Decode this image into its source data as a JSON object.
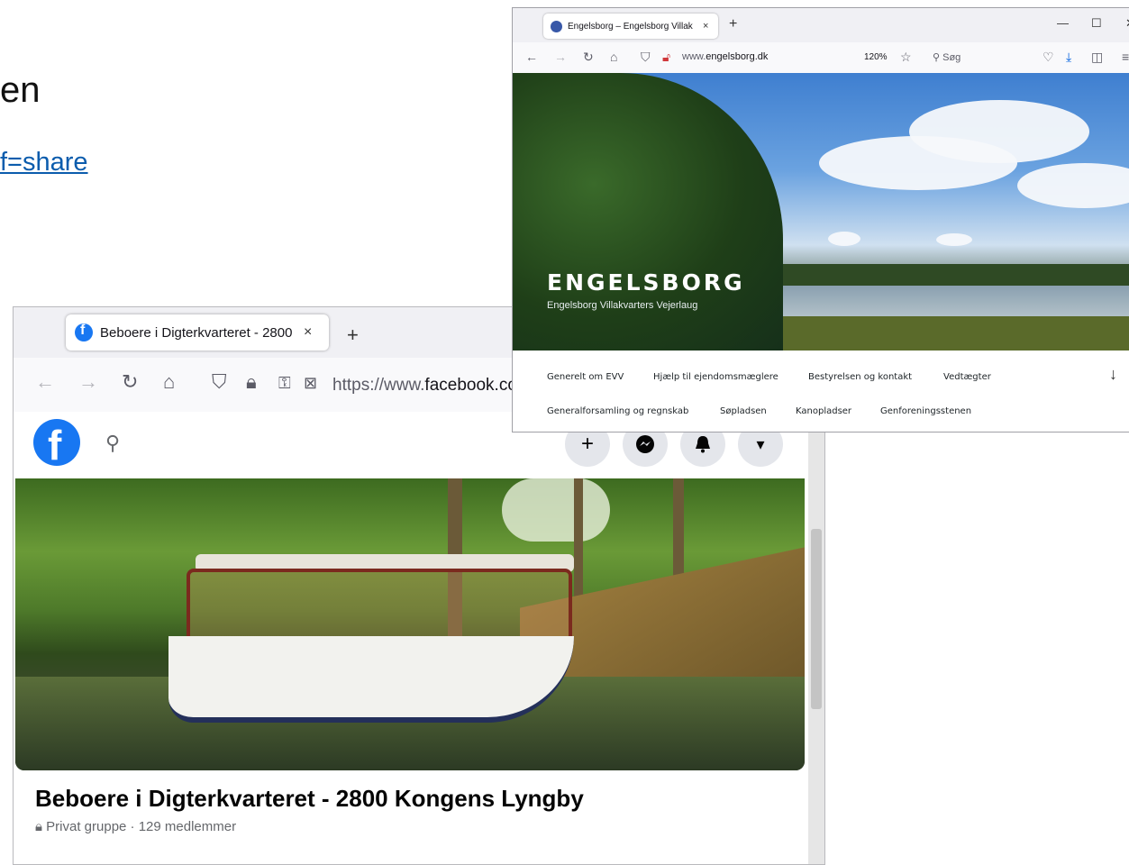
{
  "background": {
    "heading_fragment": "en",
    "link_fragment": "f=share"
  },
  "facebook_window": {
    "tab_title": "Beboere i Digterkvarteret - 2800",
    "tab_close": "×",
    "new_tab": "+",
    "url_prefix": "https://www.",
    "url_domain": "facebook.co",
    "search_icon": "search-icon",
    "nav_buttons": [
      "+",
      "messenger",
      "bell",
      "▾"
    ],
    "group_title": "Beboere i Digterkvarteret - 2800 Kongens Lyngby",
    "group_meta": "Privat gruppe · 129 medlemmer",
    "brand_color": "#1877f2"
  },
  "engelsborg_window": {
    "tab_title": "Engelsborg – Engelsborg Villak",
    "tab_close": "×",
    "new_tab": "+",
    "url_prefix": "www.",
    "url_domain": "engelsborg.dk",
    "zoom": "120%",
    "search_placeholder": "Søg",
    "site_title": "ENGELSBORG",
    "site_subtitle": "Engelsborg Villakvarters Vejerlaug",
    "menu_row1": [
      "Generelt om EVV",
      "Hjælp til ejendomsmæglere",
      "Bestyrelsen og kontakt",
      "Vedtægter"
    ],
    "menu_row2": [
      "Generalforsamling og regnskab",
      "Søpladsen",
      "Kanopladser",
      "Genforeningsstenen"
    ]
  }
}
